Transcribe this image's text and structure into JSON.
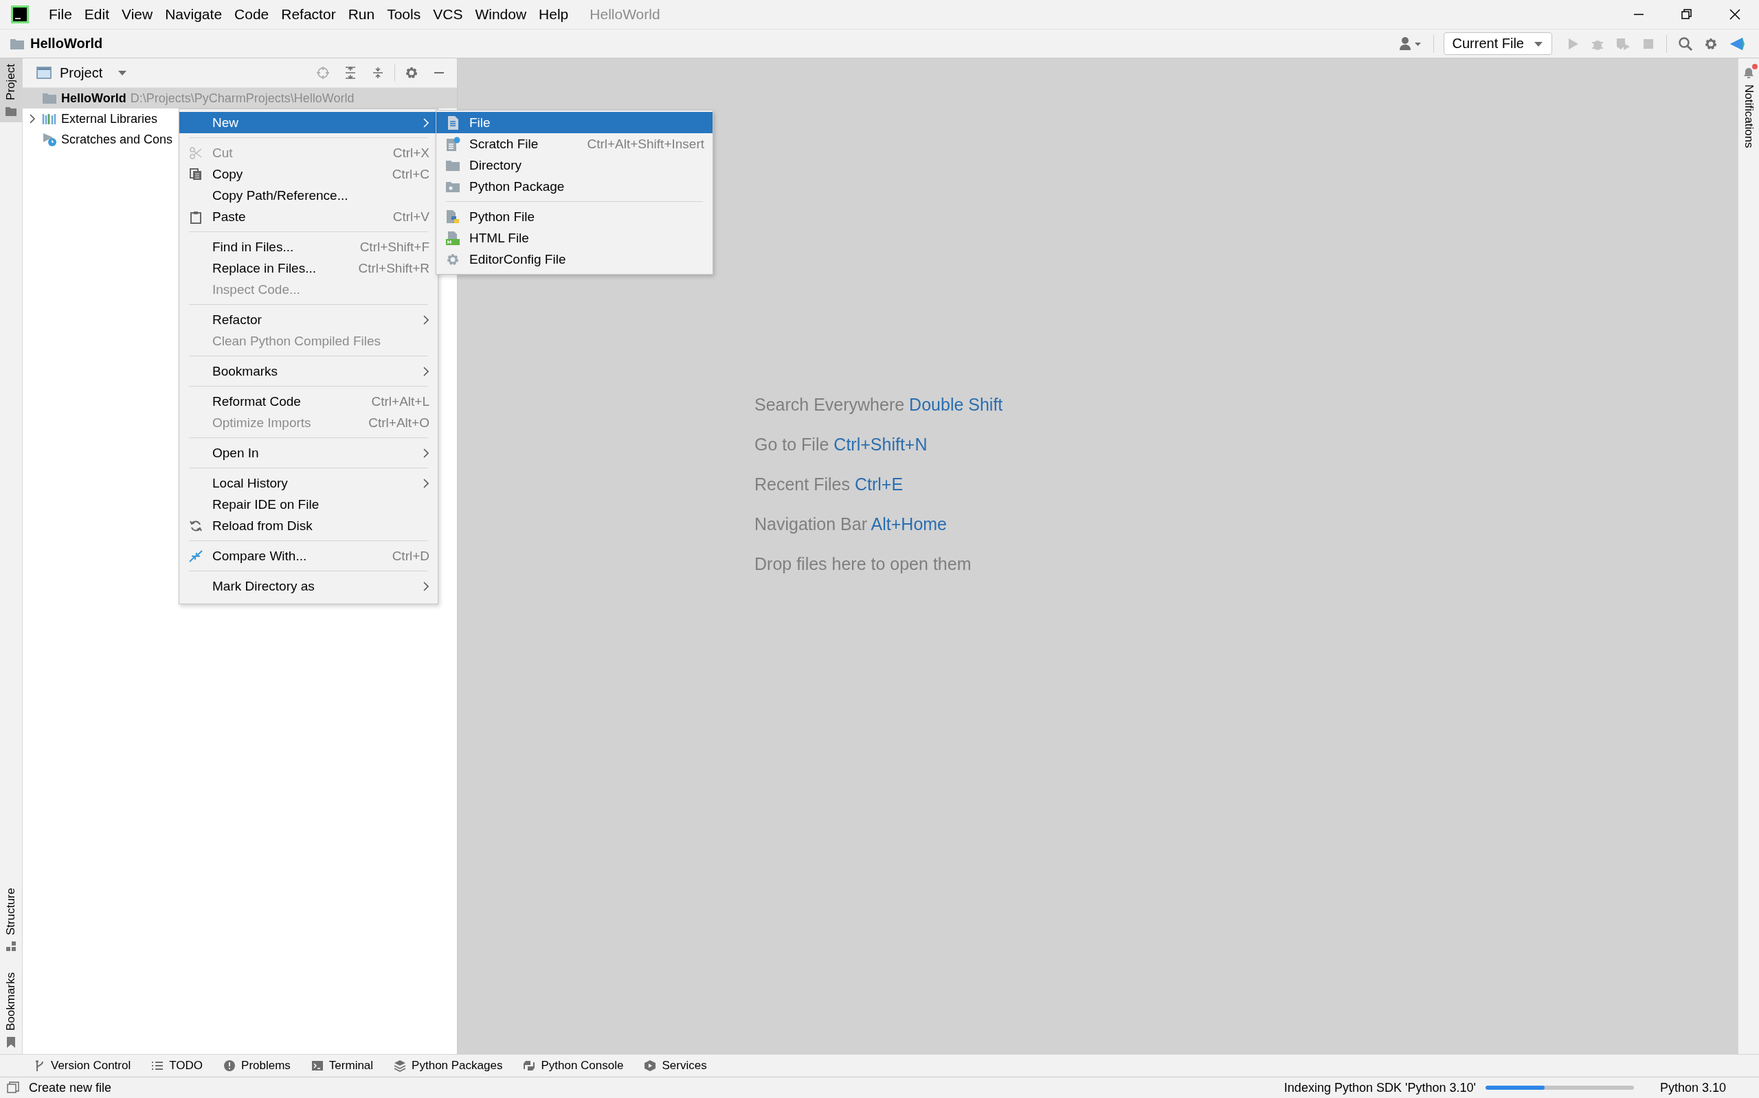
{
  "title_bar": {
    "menu": [
      {
        "label": "File"
      },
      {
        "label": "Edit"
      },
      {
        "label": "View"
      },
      {
        "label": "Navigate"
      },
      {
        "label": "Code"
      },
      {
        "label": "Refactor"
      },
      {
        "label": "Run"
      },
      {
        "label": "Tools"
      },
      {
        "label": "VCS"
      },
      {
        "label": "Window"
      },
      {
        "label": "Help"
      }
    ],
    "title": "HelloWorld"
  },
  "nav_bar": {
    "breadcrumb": "HelloWorld",
    "run_config": "Current File"
  },
  "left_stripe": [
    {
      "label": "Project",
      "selected": true
    },
    {
      "label": "Structure",
      "selected": false
    },
    {
      "label": "Bookmarks",
      "selected": false
    }
  ],
  "right_stripe": [
    {
      "label": "Notifications"
    }
  ],
  "project_panel": {
    "title": "Project",
    "tree": [
      {
        "label": "HelloWorld",
        "path": "D:\\Projects\\PyCharmProjects\\HelloWorld",
        "selected": true,
        "expandable": false
      },
      {
        "label": "External Libraries",
        "selected": false,
        "expandable": true
      },
      {
        "label": "Scratches and Cons",
        "selected": false,
        "expandable": false
      }
    ]
  },
  "context_menu": {
    "groups": [
      [
        {
          "label": "New",
          "selected": true,
          "disabled": false,
          "submenu": true
        }
      ],
      [
        {
          "label": "Cut",
          "shortcut": "Ctrl+X",
          "selected": false,
          "disabled": true,
          "submenu": false
        },
        {
          "label": "Copy",
          "shortcut": "Ctrl+C",
          "selected": false,
          "disabled": false,
          "submenu": false
        },
        {
          "label": "Copy Path/Reference...",
          "selected": false,
          "disabled": false,
          "submenu": false
        },
        {
          "label": "Paste",
          "shortcut": "Ctrl+V",
          "selected": false,
          "disabled": false,
          "submenu": false
        }
      ],
      [
        {
          "label": "Find in Files...",
          "shortcut": "Ctrl+Shift+F",
          "selected": false,
          "disabled": false,
          "submenu": false
        },
        {
          "label": "Replace in Files...",
          "shortcut": "Ctrl+Shift+R",
          "selected": false,
          "disabled": false,
          "submenu": false
        },
        {
          "label": "Inspect Code...",
          "selected": false,
          "disabled": true,
          "submenu": false
        }
      ],
      [
        {
          "label": "Refactor",
          "selected": false,
          "disabled": false,
          "submenu": true
        },
        {
          "label": "Clean Python Compiled Files",
          "selected": false,
          "disabled": true,
          "submenu": false
        }
      ],
      [
        {
          "label": "Bookmarks",
          "selected": false,
          "disabled": false,
          "submenu": true
        }
      ],
      [
        {
          "label": "Reformat Code",
          "shortcut": "Ctrl+Alt+L",
          "selected": false,
          "disabled": false,
          "submenu": false
        },
        {
          "label": "Optimize Imports",
          "shortcut": "Ctrl+Alt+O",
          "selected": false,
          "disabled": true,
          "submenu": false
        }
      ],
      [
        {
          "label": "Open In",
          "selected": false,
          "disabled": false,
          "submenu": true
        }
      ],
      [
        {
          "label": "Local History",
          "selected": false,
          "disabled": false,
          "submenu": true
        },
        {
          "label": "Repair IDE on File",
          "selected": false,
          "disabled": false,
          "submenu": false
        },
        {
          "label": "Reload from Disk",
          "selected": false,
          "disabled": false,
          "submenu": false
        }
      ],
      [
        {
          "label": "Compare With...",
          "shortcut": "Ctrl+D",
          "selected": false,
          "disabled": false,
          "submenu": false
        }
      ],
      [
        {
          "label": "Mark Directory as",
          "selected": false,
          "disabled": false,
          "submenu": true
        }
      ]
    ]
  },
  "new_submenu": {
    "groups": [
      [
        {
          "label": "File",
          "selected": true
        },
        {
          "label": "Scratch File",
          "shortcut": "Ctrl+Alt+Shift+Insert",
          "selected": false
        },
        {
          "label": "Directory",
          "selected": false
        },
        {
          "label": "Python Package",
          "selected": false
        }
      ],
      [
        {
          "label": "Python File",
          "selected": false
        },
        {
          "label": "HTML File",
          "selected": false
        },
        {
          "label": "EditorConfig File",
          "selected": false
        }
      ]
    ]
  },
  "editor_hints": [
    {
      "text": "Search Everywhere",
      "shortcut": "Double Shift"
    },
    {
      "text": "Go to File",
      "shortcut": "Ctrl+Shift+N"
    },
    {
      "text": "Recent Files",
      "shortcut": "Ctrl+E"
    },
    {
      "text": "Navigation Bar",
      "shortcut": "Alt+Home"
    },
    {
      "text": "Drop files here to open them"
    }
  ],
  "tool_windows": [
    {
      "label": "Version Control"
    },
    {
      "label": "TODO"
    },
    {
      "label": "Problems"
    },
    {
      "label": "Terminal"
    },
    {
      "label": "Python Packages"
    },
    {
      "label": "Python Console"
    },
    {
      "label": "Services"
    }
  ],
  "status_bar": {
    "message": "Create new file",
    "progress": {
      "label": "Indexing Python SDK 'Python 3.10'",
      "level": 0.4
    },
    "interpreter": "Python 3.10"
  }
}
